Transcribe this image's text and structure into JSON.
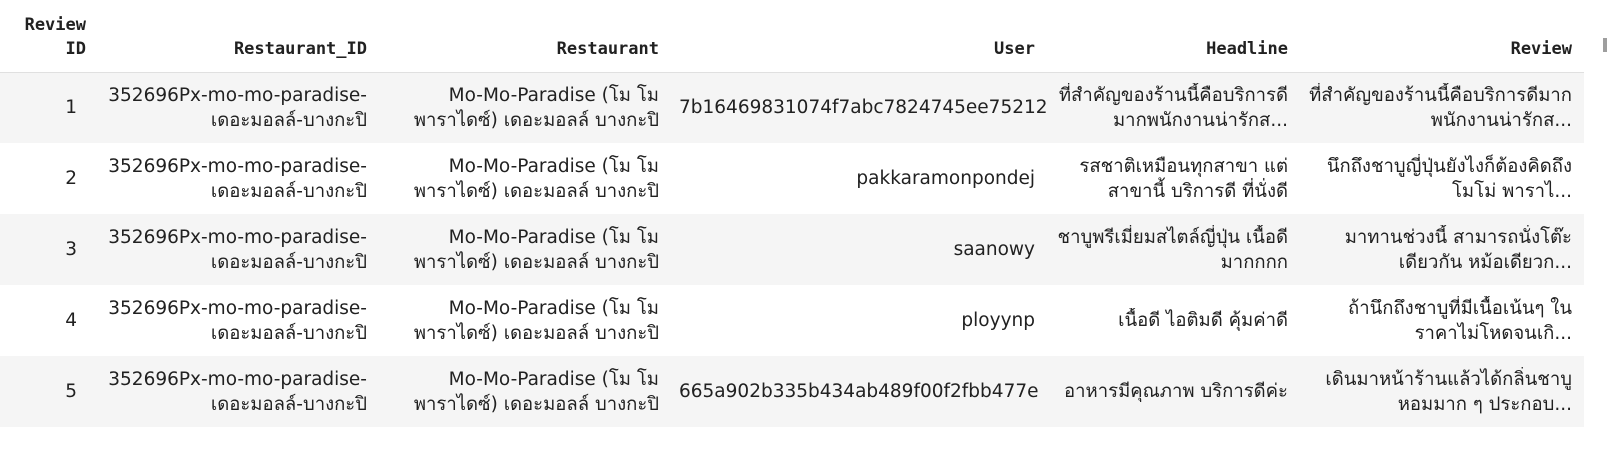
{
  "columns": [
    "Review ID",
    "Restaurant_ID",
    "Restaurant",
    "User",
    "Headline",
    "Review"
  ],
  "rows": [
    {
      "review_id": "1",
      "restaurant_id": "352696Px-mo-mo-paradise-เดอะมอลล์-บางกะปิ",
      "restaurant": "Mo-Mo-Paradise (โม โม พาราไดซ์) เดอะมอลล์ บางกะปิ",
      "user": "7b16469831074f7abc7824745ee75212",
      "headline": "ที่สำคัญของร้านนี้คือบริการดีมากพนักงานน่ารักส...",
      "review": "ที่สำคัญของร้านนี้คือบริการดีมากพนักงานน่ารักส..."
    },
    {
      "review_id": "2",
      "restaurant_id": "352696Px-mo-mo-paradise-เดอะมอลล์-บางกะปิ",
      "restaurant": "Mo-Mo-Paradise (โม โม พาราไดซ์) เดอะมอลล์ บางกะปิ",
      "user": "pakkaramonpondej",
      "headline": "รสชาติเหมือนทุกสาขา แต่สาขานี้ บริการดี ที่นั่งดี",
      "review": "นึกถึงชาบูญี่ปุ่นยังไงก็ต้องคิดถึงโมโม่ พาราไ..."
    },
    {
      "review_id": "3",
      "restaurant_id": "352696Px-mo-mo-paradise-เดอะมอลล์-บางกะปิ",
      "restaurant": "Mo-Mo-Paradise (โม โม พาราไดซ์) เดอะมอลล์ บางกะปิ",
      "user": "saanowy",
      "headline": "ชาบูพรีเมี่ยมสไตล์ญี่ปุ่น เนื้อดีมากกกก",
      "review": "มาทานช่วงนี้ สามารถนั่งโต๊ะเดียวกัน หม้อเดียวก..."
    },
    {
      "review_id": "4",
      "restaurant_id": "352696Px-mo-mo-paradise-เดอะมอลล์-บางกะปิ",
      "restaurant": "Mo-Mo-Paradise (โม โม พาราไดซ์) เดอะมอลล์ บางกะปิ",
      "user": "ployynp",
      "headline": "เนื้อดี ไอติมดี คุ้มค่าดี",
      "review": "ถ้านึกถึงชาบูที่มีเนื้อเน้นๆ ในราคาไม่โหดจนเกิ..."
    },
    {
      "review_id": "5",
      "restaurant_id": "352696Px-mo-mo-paradise-เดอะมอลล์-บางกะปิ",
      "restaurant": "Mo-Mo-Paradise (โม โม พาราไดซ์) เดอะมอลล์ บางกะปิ",
      "user": "665a902b335b434ab489f00f2fbb477e",
      "headline": "อาหารมีคุณภาพ บริการดีค่ะ",
      "review": "เดินมาหน้าร้านแล้วได้กลิ่นชาบูหอมมาก ๆ ประกอบ..."
    }
  ]
}
